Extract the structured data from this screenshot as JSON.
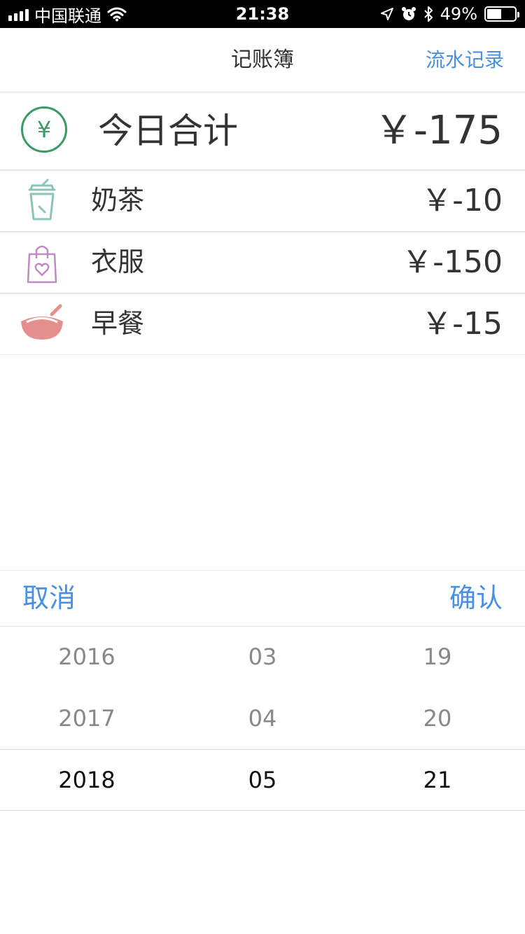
{
  "status_bar": {
    "carrier": "中国联通",
    "time": "21:38",
    "battery": "49%",
    "battery_level": 0.49
  },
  "nav": {
    "title": "记账簿",
    "right_link": "流水记录"
  },
  "summary": {
    "icon": "yen-icon",
    "icon_char": "¥",
    "label": "今日合计",
    "amount": "￥-175"
  },
  "items": [
    {
      "label": "奶茶",
      "amount": "￥-10",
      "icon": "milk-tea-cup-icon",
      "color": "#8cc5b8"
    },
    {
      "label": "衣服",
      "amount": "￥-150",
      "icon": "shopping-bag-heart-icon",
      "color": "#c08ac4"
    },
    {
      "label": "早餐",
      "amount": "￥-15",
      "icon": "rice-bowl-icon",
      "color": "#e58f8f"
    }
  ],
  "picker_toolbar": {
    "cancel": "取消",
    "confirm": "确认"
  },
  "date_picker": {
    "years": [
      "2016",
      "2017",
      "2018"
    ],
    "months": [
      "03",
      "04",
      "05"
    ],
    "days": [
      "19",
      "20",
      "21"
    ],
    "selected": {
      "year": "2018",
      "month": "05",
      "day": "21"
    }
  },
  "colors": {
    "accent": "#4a90e2",
    "total_icon": "#3a9a64"
  }
}
